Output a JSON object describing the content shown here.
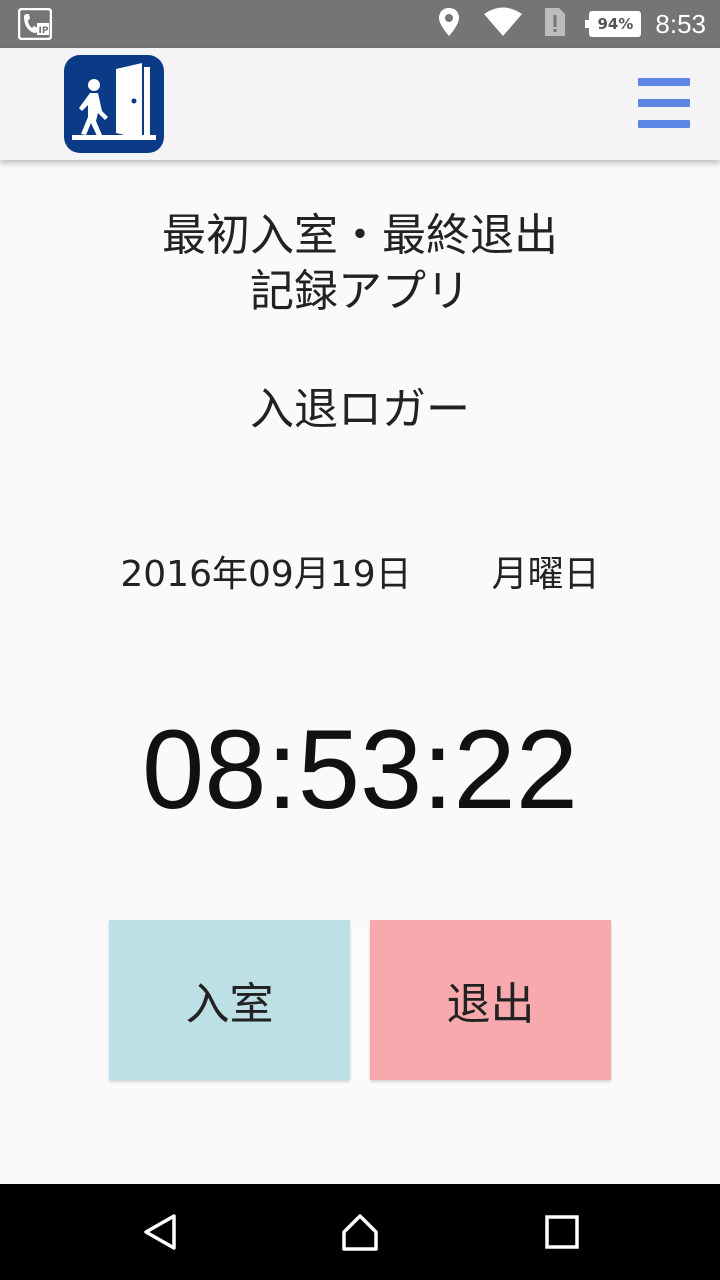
{
  "status_bar": {
    "battery": "94%",
    "time": "8:53",
    "icons": [
      "ip-phone-icon",
      "location-icon",
      "wifi-icon",
      "sim-alert-icon",
      "battery-icon"
    ]
  },
  "app_bar": {
    "logo_icon": "exit-door-person-icon",
    "menu_icon": "hamburger-menu-icon",
    "accent_color": "#5b86e5",
    "logo_color": "#0b3a86"
  },
  "main": {
    "title_line1": "最初入室・最終退出",
    "title_line2": "記録アプリ",
    "app_name": "入退ロガー",
    "date": "2016年09月19日",
    "weekday": "月曜日",
    "clock": "08:53:22"
  },
  "actions": {
    "enter_label": "入室",
    "exit_label": "退出",
    "enter_color": "#bde0e6",
    "exit_color": "#f8a9ad"
  },
  "nav_bar": {
    "icons": [
      "back-icon",
      "home-icon",
      "recent-apps-icon"
    ]
  }
}
